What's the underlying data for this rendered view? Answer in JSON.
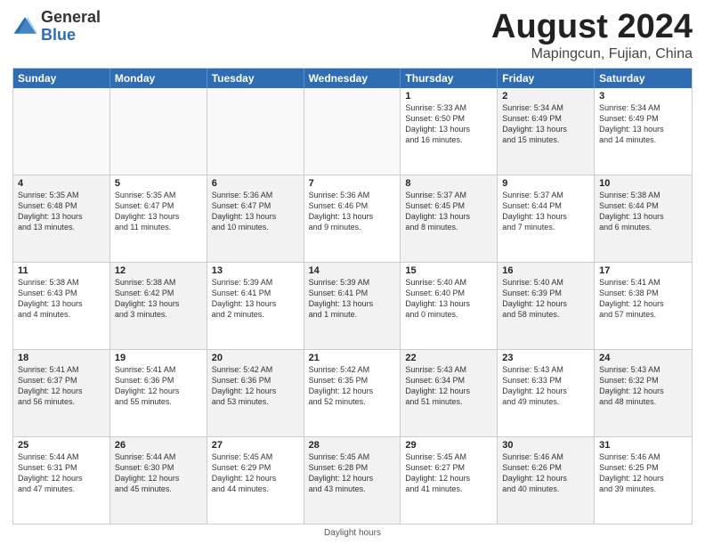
{
  "logo": {
    "general": "General",
    "blue": "Blue"
  },
  "title": {
    "month_year": "August 2024",
    "location": "Mapingcun, Fujian, China"
  },
  "days_of_week": [
    "Sunday",
    "Monday",
    "Tuesday",
    "Wednesday",
    "Thursday",
    "Friday",
    "Saturday"
  ],
  "footer": {
    "daylight_hours": "Daylight hours"
  },
  "weeks": [
    {
      "cells": [
        {
          "day": "",
          "text": "",
          "empty": true
        },
        {
          "day": "",
          "text": "",
          "empty": true
        },
        {
          "day": "",
          "text": "",
          "empty": true
        },
        {
          "day": "",
          "text": "",
          "empty": true
        },
        {
          "day": "1",
          "text": "Sunrise: 5:33 AM\nSunset: 6:50 PM\nDaylight: 13 hours\nand 16 minutes.",
          "shaded": false
        },
        {
          "day": "2",
          "text": "Sunrise: 5:34 AM\nSunset: 6:49 PM\nDaylight: 13 hours\nand 15 minutes.",
          "shaded": true
        },
        {
          "day": "3",
          "text": "Sunrise: 5:34 AM\nSunset: 6:49 PM\nDaylight: 13 hours\nand 14 minutes.",
          "shaded": false
        }
      ]
    },
    {
      "cells": [
        {
          "day": "4",
          "text": "Sunrise: 5:35 AM\nSunset: 6:48 PM\nDaylight: 13 hours\nand 13 minutes.",
          "shaded": true
        },
        {
          "day": "5",
          "text": "Sunrise: 5:35 AM\nSunset: 6:47 PM\nDaylight: 13 hours\nand 11 minutes.",
          "shaded": false
        },
        {
          "day": "6",
          "text": "Sunrise: 5:36 AM\nSunset: 6:47 PM\nDaylight: 13 hours\nand 10 minutes.",
          "shaded": true
        },
        {
          "day": "7",
          "text": "Sunrise: 5:36 AM\nSunset: 6:46 PM\nDaylight: 13 hours\nand 9 minutes.",
          "shaded": false
        },
        {
          "day": "8",
          "text": "Sunrise: 5:37 AM\nSunset: 6:45 PM\nDaylight: 13 hours\nand 8 minutes.",
          "shaded": true
        },
        {
          "day": "9",
          "text": "Sunrise: 5:37 AM\nSunset: 6:44 PM\nDaylight: 13 hours\nand 7 minutes.",
          "shaded": false
        },
        {
          "day": "10",
          "text": "Sunrise: 5:38 AM\nSunset: 6:44 PM\nDaylight: 13 hours\nand 6 minutes.",
          "shaded": true
        }
      ]
    },
    {
      "cells": [
        {
          "day": "11",
          "text": "Sunrise: 5:38 AM\nSunset: 6:43 PM\nDaylight: 13 hours\nand 4 minutes.",
          "shaded": false
        },
        {
          "day": "12",
          "text": "Sunrise: 5:38 AM\nSunset: 6:42 PM\nDaylight: 13 hours\nand 3 minutes.",
          "shaded": true
        },
        {
          "day": "13",
          "text": "Sunrise: 5:39 AM\nSunset: 6:41 PM\nDaylight: 13 hours\nand 2 minutes.",
          "shaded": false
        },
        {
          "day": "14",
          "text": "Sunrise: 5:39 AM\nSunset: 6:41 PM\nDaylight: 13 hours\nand 1 minute.",
          "shaded": true
        },
        {
          "day": "15",
          "text": "Sunrise: 5:40 AM\nSunset: 6:40 PM\nDaylight: 13 hours\nand 0 minutes.",
          "shaded": false
        },
        {
          "day": "16",
          "text": "Sunrise: 5:40 AM\nSunset: 6:39 PM\nDaylight: 12 hours\nand 58 minutes.",
          "shaded": true
        },
        {
          "day": "17",
          "text": "Sunrise: 5:41 AM\nSunset: 6:38 PM\nDaylight: 12 hours\nand 57 minutes.",
          "shaded": false
        }
      ]
    },
    {
      "cells": [
        {
          "day": "18",
          "text": "Sunrise: 5:41 AM\nSunset: 6:37 PM\nDaylight: 12 hours\nand 56 minutes.",
          "shaded": true
        },
        {
          "day": "19",
          "text": "Sunrise: 5:41 AM\nSunset: 6:36 PM\nDaylight: 12 hours\nand 55 minutes.",
          "shaded": false
        },
        {
          "day": "20",
          "text": "Sunrise: 5:42 AM\nSunset: 6:36 PM\nDaylight: 12 hours\nand 53 minutes.",
          "shaded": true
        },
        {
          "day": "21",
          "text": "Sunrise: 5:42 AM\nSunset: 6:35 PM\nDaylight: 12 hours\nand 52 minutes.",
          "shaded": false
        },
        {
          "day": "22",
          "text": "Sunrise: 5:43 AM\nSunset: 6:34 PM\nDaylight: 12 hours\nand 51 minutes.",
          "shaded": true
        },
        {
          "day": "23",
          "text": "Sunrise: 5:43 AM\nSunset: 6:33 PM\nDaylight: 12 hours\nand 49 minutes.",
          "shaded": false
        },
        {
          "day": "24",
          "text": "Sunrise: 5:43 AM\nSunset: 6:32 PM\nDaylight: 12 hours\nand 48 minutes.",
          "shaded": true
        }
      ]
    },
    {
      "cells": [
        {
          "day": "25",
          "text": "Sunrise: 5:44 AM\nSunset: 6:31 PM\nDaylight: 12 hours\nand 47 minutes.",
          "shaded": false
        },
        {
          "day": "26",
          "text": "Sunrise: 5:44 AM\nSunset: 6:30 PM\nDaylight: 12 hours\nand 45 minutes.",
          "shaded": true
        },
        {
          "day": "27",
          "text": "Sunrise: 5:45 AM\nSunset: 6:29 PM\nDaylight: 12 hours\nand 44 minutes.",
          "shaded": false
        },
        {
          "day": "28",
          "text": "Sunrise: 5:45 AM\nSunset: 6:28 PM\nDaylight: 12 hours\nand 43 minutes.",
          "shaded": true
        },
        {
          "day": "29",
          "text": "Sunrise: 5:45 AM\nSunset: 6:27 PM\nDaylight: 12 hours\nand 41 minutes.",
          "shaded": false
        },
        {
          "day": "30",
          "text": "Sunrise: 5:46 AM\nSunset: 6:26 PM\nDaylight: 12 hours\nand 40 minutes.",
          "shaded": true
        },
        {
          "day": "31",
          "text": "Sunrise: 5:46 AM\nSunset: 6:25 PM\nDaylight: 12 hours\nand 39 minutes.",
          "shaded": false
        }
      ]
    }
  ]
}
